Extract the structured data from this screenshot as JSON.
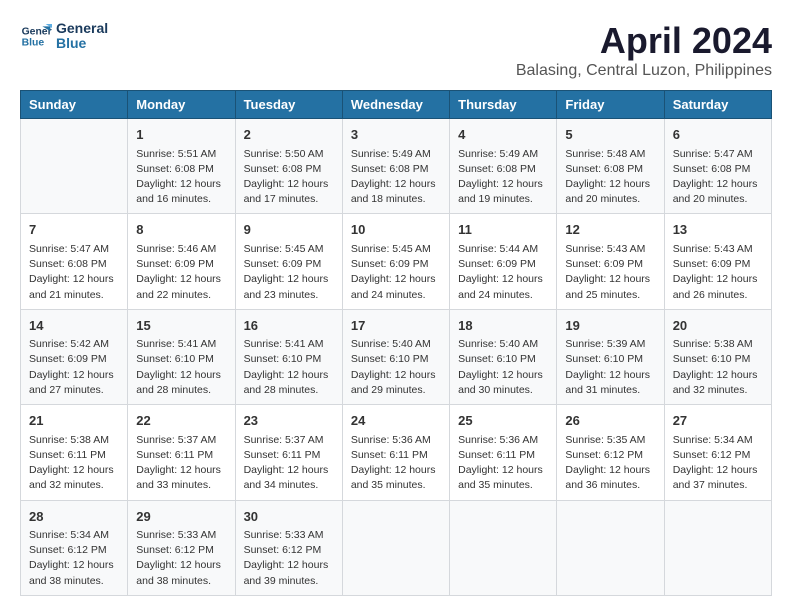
{
  "logo": {
    "line1": "General",
    "line2": "Blue"
  },
  "title": "April 2024",
  "subtitle": "Balasing, Central Luzon, Philippines",
  "headers": [
    "Sunday",
    "Monday",
    "Tuesday",
    "Wednesday",
    "Thursday",
    "Friday",
    "Saturday"
  ],
  "weeks": [
    [
      {
        "day": "",
        "info": ""
      },
      {
        "day": "1",
        "info": "Sunrise: 5:51 AM\nSunset: 6:08 PM\nDaylight: 12 hours\nand 16 minutes."
      },
      {
        "day": "2",
        "info": "Sunrise: 5:50 AM\nSunset: 6:08 PM\nDaylight: 12 hours\nand 17 minutes."
      },
      {
        "day": "3",
        "info": "Sunrise: 5:49 AM\nSunset: 6:08 PM\nDaylight: 12 hours\nand 18 minutes."
      },
      {
        "day": "4",
        "info": "Sunrise: 5:49 AM\nSunset: 6:08 PM\nDaylight: 12 hours\nand 19 minutes."
      },
      {
        "day": "5",
        "info": "Sunrise: 5:48 AM\nSunset: 6:08 PM\nDaylight: 12 hours\nand 20 minutes."
      },
      {
        "day": "6",
        "info": "Sunrise: 5:47 AM\nSunset: 6:08 PM\nDaylight: 12 hours\nand 20 minutes."
      }
    ],
    [
      {
        "day": "7",
        "info": "Sunrise: 5:47 AM\nSunset: 6:08 PM\nDaylight: 12 hours\nand 21 minutes."
      },
      {
        "day": "8",
        "info": "Sunrise: 5:46 AM\nSunset: 6:09 PM\nDaylight: 12 hours\nand 22 minutes."
      },
      {
        "day": "9",
        "info": "Sunrise: 5:45 AM\nSunset: 6:09 PM\nDaylight: 12 hours\nand 23 minutes."
      },
      {
        "day": "10",
        "info": "Sunrise: 5:45 AM\nSunset: 6:09 PM\nDaylight: 12 hours\nand 24 minutes."
      },
      {
        "day": "11",
        "info": "Sunrise: 5:44 AM\nSunset: 6:09 PM\nDaylight: 12 hours\nand 24 minutes."
      },
      {
        "day": "12",
        "info": "Sunrise: 5:43 AM\nSunset: 6:09 PM\nDaylight: 12 hours\nand 25 minutes."
      },
      {
        "day": "13",
        "info": "Sunrise: 5:43 AM\nSunset: 6:09 PM\nDaylight: 12 hours\nand 26 minutes."
      }
    ],
    [
      {
        "day": "14",
        "info": "Sunrise: 5:42 AM\nSunset: 6:09 PM\nDaylight: 12 hours\nand 27 minutes."
      },
      {
        "day": "15",
        "info": "Sunrise: 5:41 AM\nSunset: 6:10 PM\nDaylight: 12 hours\nand 28 minutes."
      },
      {
        "day": "16",
        "info": "Sunrise: 5:41 AM\nSunset: 6:10 PM\nDaylight: 12 hours\nand 28 minutes."
      },
      {
        "day": "17",
        "info": "Sunrise: 5:40 AM\nSunset: 6:10 PM\nDaylight: 12 hours\nand 29 minutes."
      },
      {
        "day": "18",
        "info": "Sunrise: 5:40 AM\nSunset: 6:10 PM\nDaylight: 12 hours\nand 30 minutes."
      },
      {
        "day": "19",
        "info": "Sunrise: 5:39 AM\nSunset: 6:10 PM\nDaylight: 12 hours\nand 31 minutes."
      },
      {
        "day": "20",
        "info": "Sunrise: 5:38 AM\nSunset: 6:10 PM\nDaylight: 12 hours\nand 32 minutes."
      }
    ],
    [
      {
        "day": "21",
        "info": "Sunrise: 5:38 AM\nSunset: 6:11 PM\nDaylight: 12 hours\nand 32 minutes."
      },
      {
        "day": "22",
        "info": "Sunrise: 5:37 AM\nSunset: 6:11 PM\nDaylight: 12 hours\nand 33 minutes."
      },
      {
        "day": "23",
        "info": "Sunrise: 5:37 AM\nSunset: 6:11 PM\nDaylight: 12 hours\nand 34 minutes."
      },
      {
        "day": "24",
        "info": "Sunrise: 5:36 AM\nSunset: 6:11 PM\nDaylight: 12 hours\nand 35 minutes."
      },
      {
        "day": "25",
        "info": "Sunrise: 5:36 AM\nSunset: 6:11 PM\nDaylight: 12 hours\nand 35 minutes."
      },
      {
        "day": "26",
        "info": "Sunrise: 5:35 AM\nSunset: 6:12 PM\nDaylight: 12 hours\nand 36 minutes."
      },
      {
        "day": "27",
        "info": "Sunrise: 5:34 AM\nSunset: 6:12 PM\nDaylight: 12 hours\nand 37 minutes."
      }
    ],
    [
      {
        "day": "28",
        "info": "Sunrise: 5:34 AM\nSunset: 6:12 PM\nDaylight: 12 hours\nand 38 minutes."
      },
      {
        "day": "29",
        "info": "Sunrise: 5:33 AM\nSunset: 6:12 PM\nDaylight: 12 hours\nand 38 minutes."
      },
      {
        "day": "30",
        "info": "Sunrise: 5:33 AM\nSunset: 6:12 PM\nDaylight: 12 hours\nand 39 minutes."
      },
      {
        "day": "",
        "info": ""
      },
      {
        "day": "",
        "info": ""
      },
      {
        "day": "",
        "info": ""
      },
      {
        "day": "",
        "info": ""
      }
    ]
  ]
}
